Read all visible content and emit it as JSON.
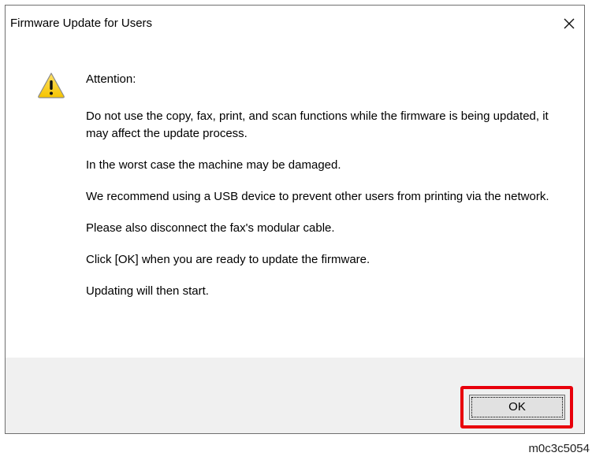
{
  "dialog": {
    "title": "Firmware Update for Users",
    "icon": "warning-icon",
    "close_icon": "close-icon",
    "heading": "Attention:",
    "paragraphs": [
      "Do not use the copy, fax, print, and scan functions while the firmware is being updated, it may affect the update process.",
      "In the worst case the machine may be damaged.",
      "We recommend using a USB device to prevent other users from printing via the network.",
      "Please also disconnect the fax's modular cable.",
      "Click [OK] when you are ready to update the firmware.",
      "Updating will then start."
    ],
    "ok_label": "OK"
  },
  "colors": {
    "highlight": "#e8000b",
    "footer_background": "#f0f0f0",
    "warning_yellow": "#f5c400"
  },
  "figure_code": "m0c3c5054"
}
